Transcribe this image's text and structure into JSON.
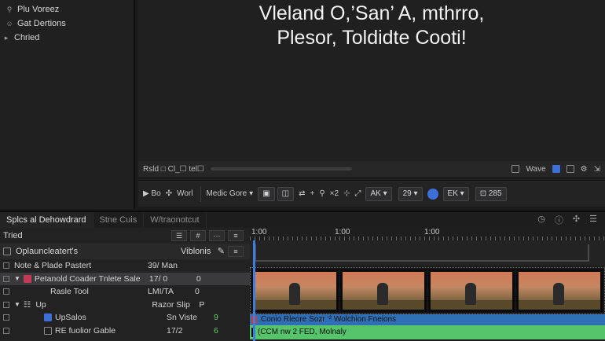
{
  "project": {
    "items": [
      {
        "label": "Plu Voreez",
        "icon": "pin-icon"
      },
      {
        "label": "Gat Dertions",
        "icon": "user-icon"
      },
      {
        "label": "Chried",
        "icon": "folder-icon"
      }
    ]
  },
  "viewer": {
    "title_line1": "Vleland O,’San’ A, mthrro,",
    "title_line2": "Plesor, Toldidte Cooti!",
    "bar_label": "Rsld  □ Cl_☐ tel☐"
  },
  "viewer_bar": {
    "right_label": "Wave"
  },
  "tools": {
    "play": "▶ Bo",
    "word": "Worl",
    "media": "Medic Gore",
    "counter": "×2",
    "ak": "AK",
    "n29": "29",
    "ek": "EK",
    "n285": "285"
  },
  "tabs": {
    "active": "Splcs al Dehowdrard",
    "tab2": "Stne Cuis",
    "tab3": "W/traonotcut"
  },
  "tracks": {
    "header": "Tried",
    "subheader": "Oplauncleatert's",
    "subheader_right": "Viblonis",
    "rows": [
      {
        "name": "Note & Plade Pastert",
        "c2": "39/ Man",
        "c3": ""
      },
      {
        "name": "Petanold Coader Tnlete Sale",
        "c2": "17/ 0",
        "c3": "0"
      },
      {
        "name": "Rasle Tool",
        "c2": "LMI/TA",
        "c3": "0"
      },
      {
        "name": "Up",
        "c2": "Razor Slip",
        "c3": "P"
      },
      {
        "name": "UpSalos",
        "c2": "Sn Viste",
        "c3": "9"
      },
      {
        "name": "RE fuolior Gable",
        "c2": "17/2",
        "c3": "6"
      }
    ]
  },
  "ruler": {
    "t1": "1:00",
    "t2": "1:00",
    "t3": "1:00"
  },
  "audio": {
    "track1": "Conio Rleore Sozr ‘² Wolchion Fneions",
    "track2": "(CCM nw 2 FED, Molnaly"
  }
}
